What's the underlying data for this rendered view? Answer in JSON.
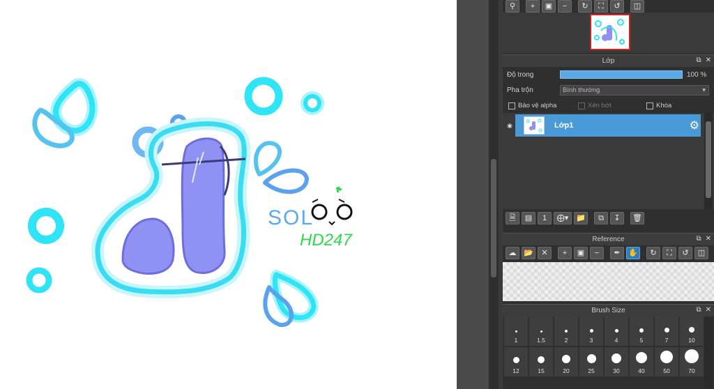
{
  "navigator": {
    "toolbar_icons": [
      "zoom-icon",
      "zoom-in-icon",
      "fit-icon",
      "zoom-out-icon",
      "rotate-icon",
      "fullscreen-icon",
      "reset-rotate-icon",
      "flip-icon"
    ]
  },
  "layer_panel": {
    "title": "Lớp",
    "opacity_label": "Độ trong",
    "opacity_value": "100 %",
    "opacity_percent": 100,
    "blend_label": "Pha trộn",
    "blend_value": "Bình thường",
    "protect_alpha_label": "Bảo vệ alpha",
    "clipping_label": "Xén bớt",
    "lock_label": "Khóa",
    "layers": [
      {
        "name": "Lớp1",
        "selected": true
      }
    ]
  },
  "reference_panel": {
    "title": "Reference"
  },
  "brush_size_panel": {
    "title": "Brush Size",
    "sizes": [
      "1",
      "1.5",
      "2",
      "3",
      "4",
      "5",
      "7",
      "10",
      "12",
      "15",
      "20",
      "25",
      "30",
      "40",
      "50",
      "70"
    ]
  },
  "canvas": {
    "signature_text": "SOL O_O HD247",
    "colors": {
      "cyan": "#2ee4f5",
      "blue": "#5aa2ee",
      "violet": "#8c8cf2",
      "green": "#2fd84a"
    }
  }
}
